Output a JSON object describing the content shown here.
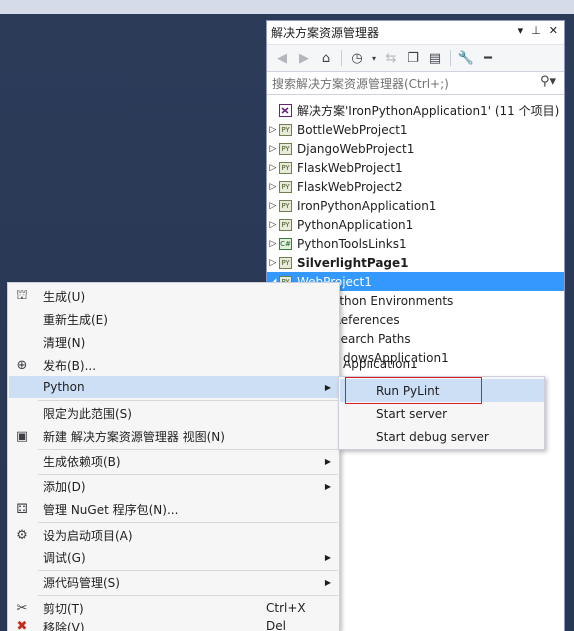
{
  "solution_explorer": {
    "title": "解决方案资源管理器",
    "title_controls": [
      "▾",
      "⊥",
      "✕"
    ],
    "search_placeholder": "搜索解决方案资源管理器(Ctrl+;)",
    "solution_label": "解决方案'IronPythonApplication1' (11 个项目)",
    "projects": [
      {
        "name": "BottleWebProject1",
        "icon": "python-project-icon",
        "tag": "PY"
      },
      {
        "name": "DjangoWebProject1",
        "icon": "python-project-icon",
        "tag": "PY"
      },
      {
        "name": "FlaskWebProject1",
        "icon": "python-project-icon",
        "tag": "PY"
      },
      {
        "name": "FlaskWebProject2",
        "icon": "python-project-icon",
        "tag": "PY"
      },
      {
        "name": "IronPythonApplication1",
        "icon": "python-project-icon",
        "tag": "PY"
      },
      {
        "name": "PythonApplication1",
        "icon": "python-project-icon",
        "tag": "PY"
      },
      {
        "name": "PythonToolsLinks1",
        "icon": "csharp-project-icon",
        "tag": "C#"
      },
      {
        "name": "SilverlightPage1",
        "icon": "python-project-icon",
        "tag": "PY"
      },
      {
        "name": "WebProject1",
        "icon": "python-project-icon",
        "tag": "PY"
      }
    ],
    "children_partial": [
      "Python Environments",
      "References",
      "Search Paths",
      "dowsApplication1",
      "Application1"
    ]
  },
  "context_menu": {
    "items": [
      {
        "label": "生成(U)",
        "icon": "build-icon"
      },
      {
        "label": "重新生成(E)"
      },
      {
        "label": "清理(N)"
      },
      {
        "label": "发布(B)...",
        "icon": "publish-globe-icon"
      },
      {
        "label": "Python",
        "submenu": true
      },
      {
        "label": "限定为此范围(S)"
      },
      {
        "label": "新建 解决方案资源管理器 视图(N)",
        "icon": "new-view-icon"
      },
      {
        "label": "生成依赖项(B)",
        "submenu": true
      },
      {
        "label": "添加(D)",
        "submenu": true
      },
      {
        "label": "管理 NuGet 程序包(N)...",
        "icon": "nuget-icon"
      },
      {
        "label": "设为启动项目(A)",
        "icon": "gear-icon"
      },
      {
        "label": "调试(G)",
        "submenu": true
      },
      {
        "label": "源代码管理(S)",
        "submenu": true
      },
      {
        "label": "剪切(T)",
        "shortcut": "Ctrl+X",
        "icon": "scissors-icon"
      },
      {
        "label": "移除(V)",
        "shortcut": "Del",
        "icon": "remove-x-icon"
      }
    ]
  },
  "python_submenu": {
    "items": [
      "Run PyLint",
      "Start server",
      "Start debug server"
    ]
  },
  "colors": {
    "selection": "#3399ff",
    "menu_highlight": "#ccdff5",
    "highlight_box": "#d42020"
  }
}
